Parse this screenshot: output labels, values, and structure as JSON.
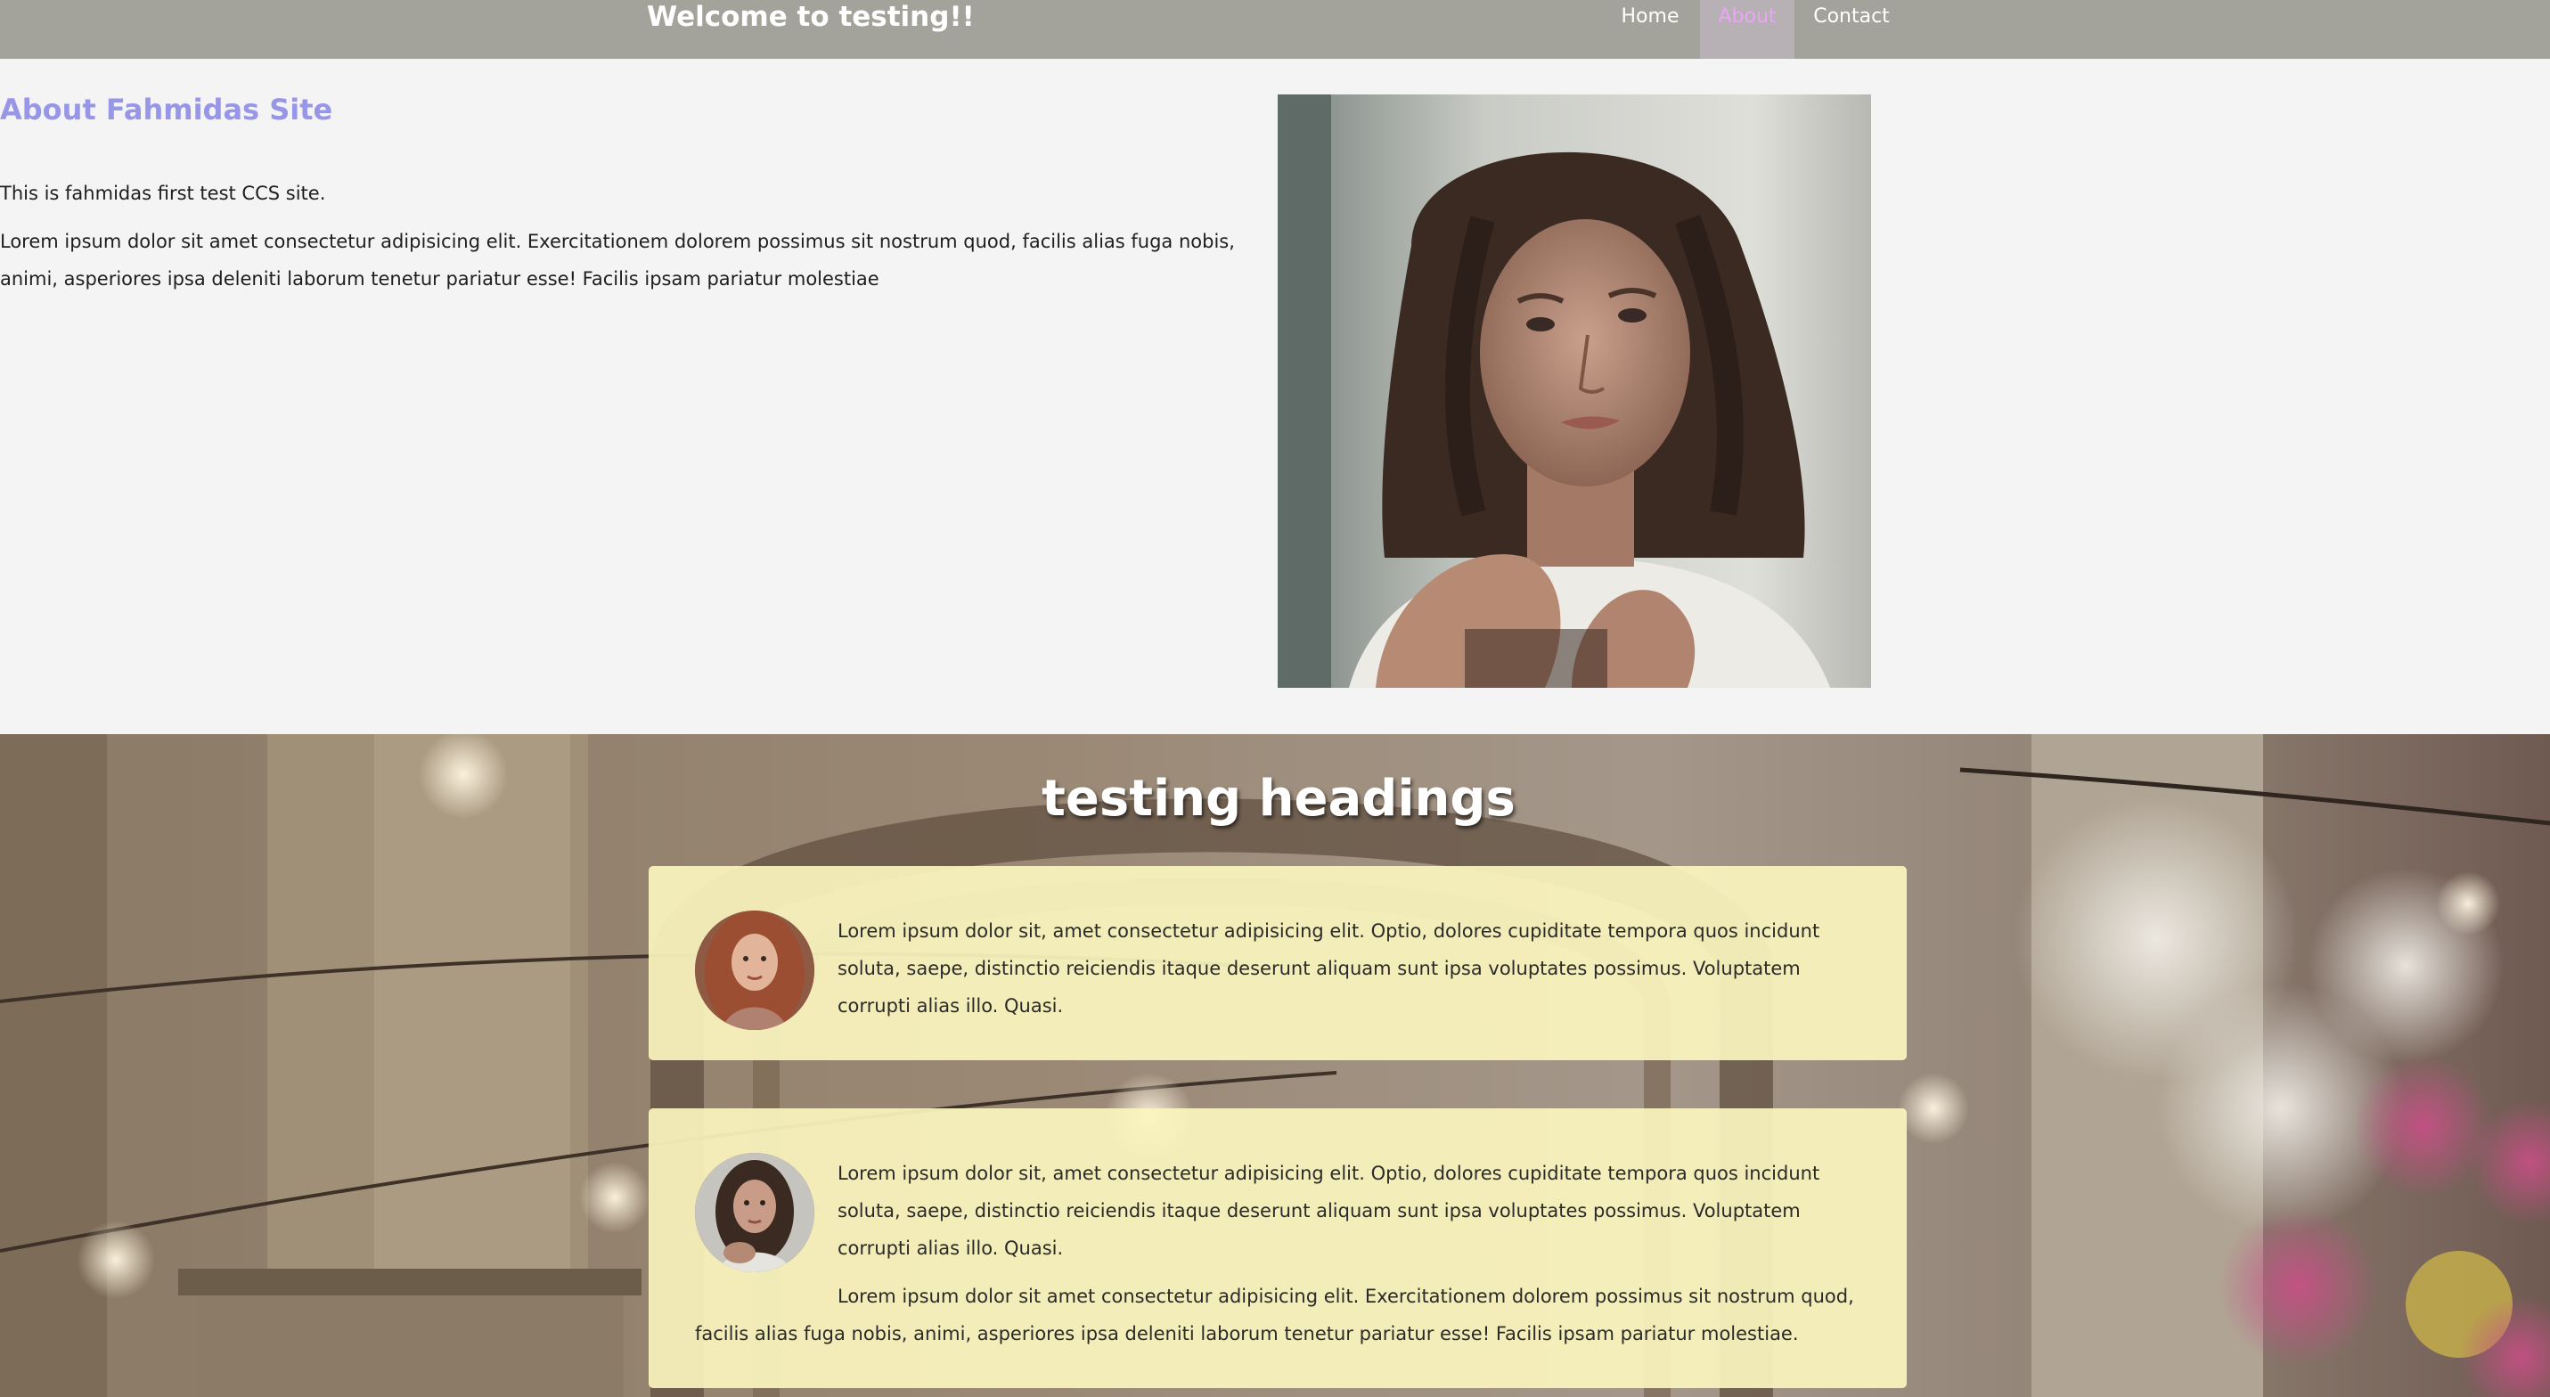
{
  "header": {
    "title": "Welcome to testing!!",
    "nav": [
      {
        "label": "Home"
      },
      {
        "label": "About",
        "active": true
      },
      {
        "label": "Contact"
      }
    ]
  },
  "about": {
    "heading": "About Fahmidas Site",
    "paragraphs": [
      "This is fahmidas first test CCS site.",
      "Lorem ipsum dolor sit amet consectetur adipisicing elit. Exercitationem dolorem possimus sit nostrum quod, facilis alias fuga nobis, animi, asperiores ipsa deleniti laborum tenetur pariatur esse! Facilis ipsam pariatur molestiae"
    ]
  },
  "testimonials": {
    "heading": "testing headings",
    "cards": [
      {
        "paragraphs": [
          "Lorem ipsum dolor sit, amet consectetur adipisicing elit. Optio, dolores cupiditate tempora quos incidunt soluta, saepe, distinctio reiciendis itaque deserunt aliquam sunt ipsa voluptates possimus. Voluptatem corrupti alias illo. Quasi."
        ]
      },
      {
        "paragraphs": [
          "Lorem ipsum dolor sit, amet consectetur adipisicing elit. Optio, dolores cupiditate tempora quos incidunt soluta, saepe, distinctio reiciendis itaque deserunt aliquam sunt ipsa voluptates possimus. Voluptatem corrupti alias illo. Quasi.",
          "Lorem ipsum dolor sit amet consectetur adipisicing elit. Exercitationem dolorem possimus sit nostrum quod, facilis alias fuga nobis, animi, asperiores ipsa deleniti laborum tenetur pariatur esse! Facilis ipsam pariatur molestiae."
        ]
      }
    ]
  },
  "colors": {
    "header_bg": "#a3a39b",
    "nav_active_bg": "#b7b0b5",
    "nav_active_text": "#e9a6f5",
    "about_heading": "#9896e6",
    "card_bg": "#faf4be",
    "page_bg": "#f4f4f4"
  },
  "images": {
    "about_photo": "portrait-photo",
    "background": "street-background-photo",
    "avatar_1": "avatar-woman-red-hair",
    "avatar_2": "avatar-woman-dark-hair"
  }
}
